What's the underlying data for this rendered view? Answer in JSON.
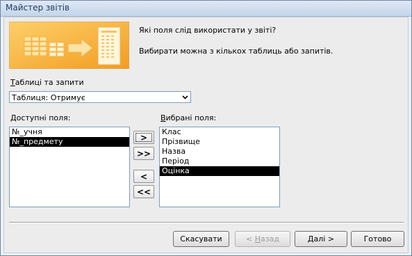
{
  "window": {
    "title": "Майстер звітів"
  },
  "prompt": {
    "line1": "Які поля слід використати у звіті?",
    "line2": "Вибирати можна з кількох таблиць або запитів."
  },
  "tables": {
    "label_underlined": "Т",
    "label_rest": "аблиці та запити",
    "selected": "Таблиця: Отримує"
  },
  "available": {
    "label_underlined": "Д",
    "label_rest": "оступні поля:",
    "items": [
      "№_учня",
      "№_предмету"
    ],
    "selected_index": 1
  },
  "selected_fields": {
    "label_underlined": "В",
    "label_rest": "ибрані поля:",
    "items": [
      "Клас",
      "Прізвище",
      "Назва",
      "Період",
      "Оцінка"
    ],
    "selected_index": 4
  },
  "move_buttons": {
    "add_one": ">",
    "add_all": ">>",
    "remove_one": "<",
    "remove_all": "<<"
  },
  "buttons": {
    "cancel": "Скасувати",
    "back_prefix": "< ",
    "back_underlined": "Н",
    "back_rest": "азад",
    "next_underlined": "Д",
    "next_rest": "алі >",
    "finish": "Готово"
  },
  "colors": {
    "selection": "#000000",
    "graphic_orange": "#f4a62a"
  }
}
